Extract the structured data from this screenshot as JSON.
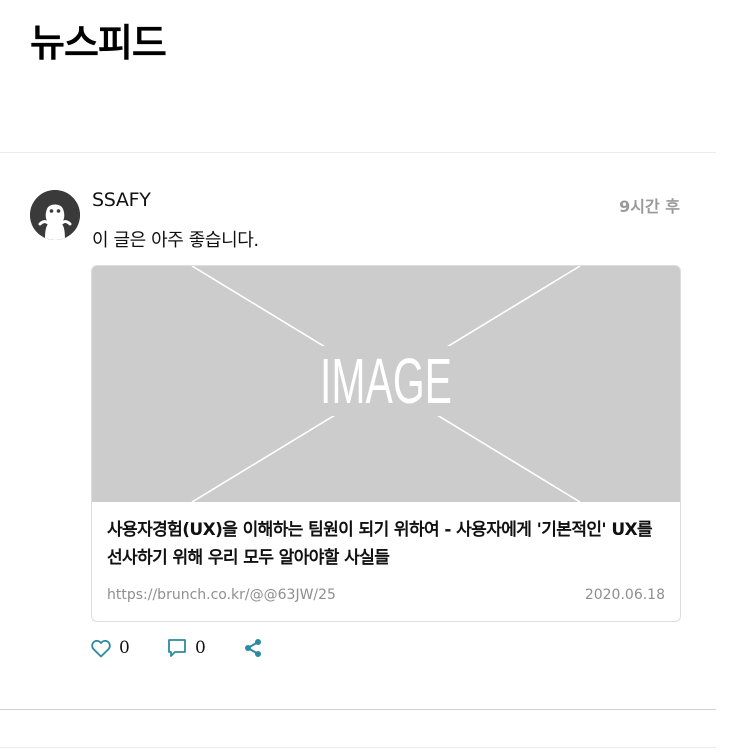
{
  "header": {
    "title": "뉴스피드"
  },
  "post": {
    "author": "SSAFY",
    "time": "9시간 후",
    "text": "이 글은 아주 좋습니다.",
    "link_card": {
      "image_placeholder": "IMAGE",
      "title": "사용자경험(UX)을 이해하는 팀원이 되기 위하여 - 사용자에게 '기본적인' UX를 선사하기 위해 우리 모두 알아야할 사실들",
      "url": "https://brunch.co.kr/@@63JW/25",
      "date": "2020.06.18"
    },
    "actions": {
      "likes": "0",
      "comments": "0"
    }
  },
  "colors": {
    "accent": "#2e8aa0",
    "muted": "#9a9a9a",
    "placeholder_bg": "#cccccc"
  },
  "icons": [
    "avatar-ghost-icon",
    "heart-icon",
    "comment-icon",
    "share-icon"
  ]
}
